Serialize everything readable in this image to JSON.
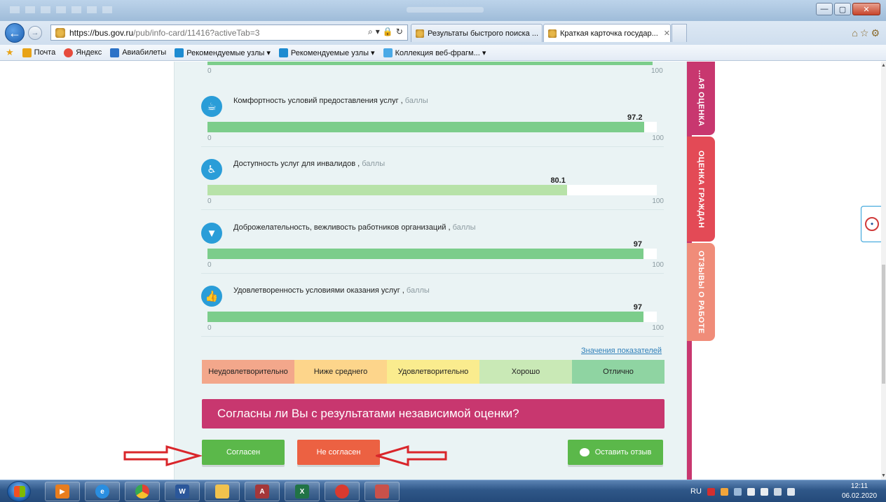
{
  "browser": {
    "url_host": "https://bus.gov.ru",
    "url_path": "/pub/info-card/11416?activeTab=3",
    "tabs": [
      {
        "label": "Результаты быстрого поиска ..."
      },
      {
        "label": "Краткая карточка государ..."
      }
    ],
    "tab_close": "✕",
    "favorites": [
      {
        "label": "Почта"
      },
      {
        "label": "Яндекс"
      },
      {
        "label": "Авиабилеты"
      },
      {
        "label": "Рекомендуемые узлы ▾"
      },
      {
        "label": "Рекомендуемые узлы ▾"
      },
      {
        "label": "Коллекция веб-фрагм... ▾"
      }
    ]
  },
  "top_bar": {
    "min": "0",
    "max": "100"
  },
  "metrics": [
    {
      "label": "Комфортность условий предоставления услуг ,",
      "unit": "баллы",
      "value": "97.2",
      "fill_pct": 97.2,
      "min": "0",
      "max": "100",
      "icon": "cup-icon",
      "glyph": "☕"
    },
    {
      "label": "Доступность услуг для инвалидов ,",
      "unit": "баллы",
      "value": "80.1",
      "fill_pct": 80.1,
      "min": "0",
      "max": "100",
      "icon": "wheelchair-icon",
      "glyph": "♿"
    },
    {
      "label": "Доброжелательность, вежливость работников организаций ,",
      "unit": "баллы",
      "value": "97",
      "fill_pct": 97,
      "min": "0",
      "max": "100",
      "icon": "tie-icon",
      "glyph": "▼"
    },
    {
      "label": "Удовлетворенность условиями оказания услуг ,",
      "unit": "баллы",
      "value": "97",
      "fill_pct": 97,
      "min": "0",
      "max": "100",
      "icon": "thumbs-up-icon",
      "glyph": "👍"
    }
  ],
  "indicators_link": "Значения показателей",
  "scale": [
    {
      "label": "Неудовлетворительно",
      "color": "#f3a78b"
    },
    {
      "label": "Ниже среднего",
      "color": "#fdd58b"
    },
    {
      "label": "Удовлетворительно",
      "color": "#faec8e"
    },
    {
      "label": "Хорошо",
      "color": "#c9e9b6"
    },
    {
      "label": "Отлично",
      "color": "#8fd4a2"
    }
  ],
  "question": "Согласны ли Вы с результатами независимой оценки?",
  "buttons": {
    "agree": "Согласен",
    "disagree": "Не согласен",
    "review": "Оставить отзыв"
  },
  "side_tabs": [
    {
      "label": "...АЯ ОЦЕНКА",
      "color": "#c8376f"
    },
    {
      "label": "ОЦЕНКА ГРАЖДАН",
      "color": "#e34a56"
    },
    {
      "label": "ОТЗЫВЫ О РАБОТЕ",
      "color": "#f08c79"
    }
  ],
  "taskbar": {
    "lang": "RU",
    "time": "12:11",
    "date": "06.02.2020"
  },
  "colors": {
    "fill_high": "#7ccd8b",
    "fill_mid": "#b7e2a8"
  }
}
